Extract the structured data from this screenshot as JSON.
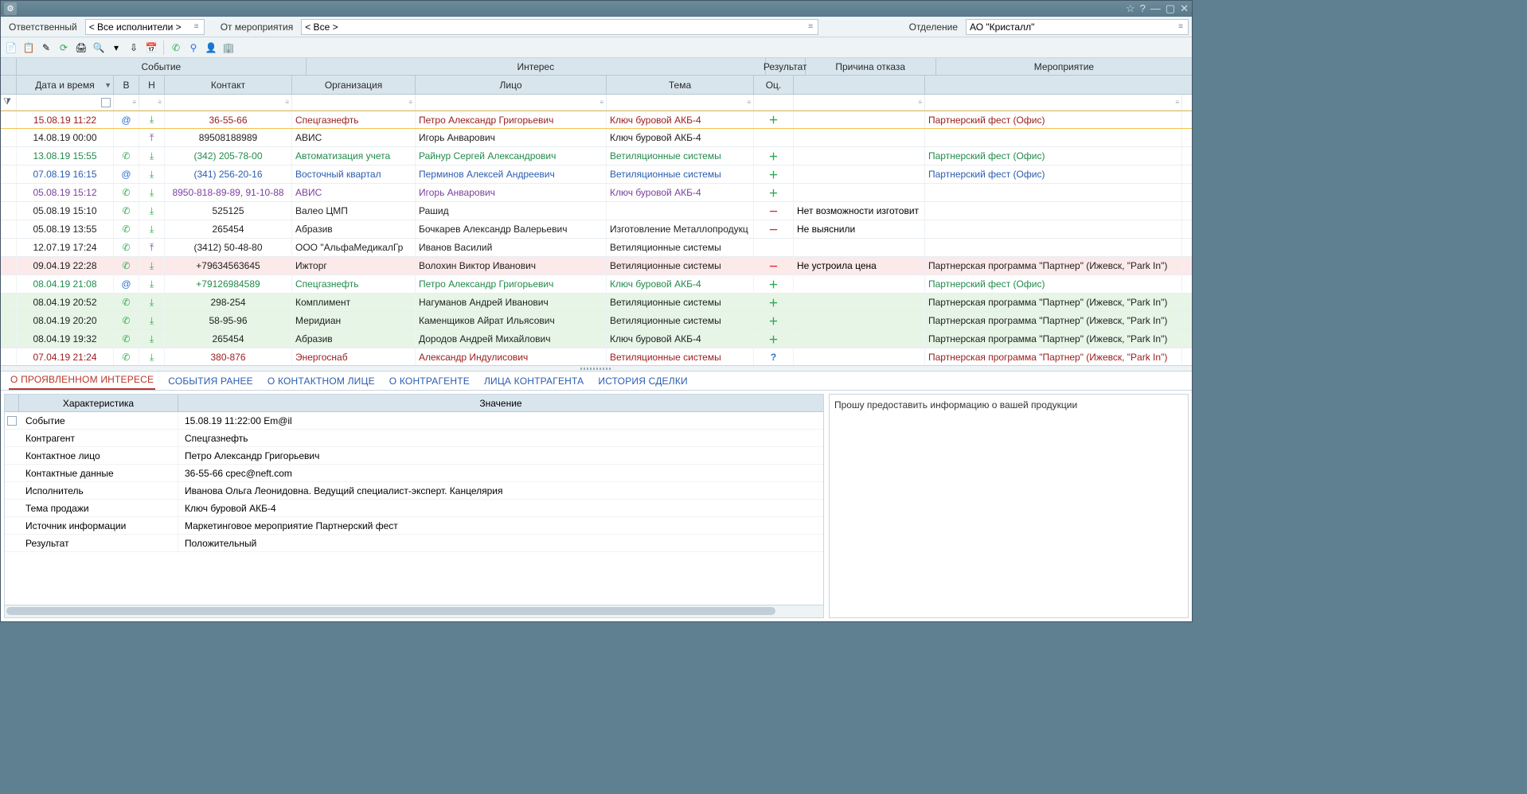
{
  "title": "",
  "filters": {
    "responsible_label": "Ответственный",
    "responsible_value": "< Все исполнители >",
    "from_event_label": "От мероприятия",
    "from_event_value": "< Все >",
    "department_label": "Отделение",
    "department_value": "АО \"Кристалл\""
  },
  "group_headers": {
    "event": "Событие",
    "interest": "Интерес",
    "result": "Результат",
    "reason": "Причина отказа",
    "meeting": "Мероприятие"
  },
  "columns": {
    "dt": "Дата и время",
    "v": "В",
    "h": "Н",
    "contact": "Контакт",
    "org": "Организация",
    "person": "Лицо",
    "theme": "Тема",
    "res": "Оц.",
    "reason": "",
    "meeting": ""
  },
  "rows": [
    {
      "dt": "15.08.19 11:22",
      "v": "at",
      "h": "in",
      "contact": "36-55-66",
      "org": "Спецгазнефть",
      "person": "Петро Александр Григорьевич",
      "theme": "Ключ буровой АКБ-4",
      "res": "plus",
      "reason": "",
      "meeting": "Партнерский фест (Офис)",
      "style": "darkred",
      "sel": true
    },
    {
      "dt": "14.08.19 00:00",
      "v": "",
      "h": "out",
      "contact": "89508188989",
      "org": "АВИС",
      "person": "Игорь Анварович",
      "theme": "Ключ буровой АКБ-4",
      "res": "",
      "reason": "",
      "meeting": "",
      "style": "black"
    },
    {
      "dt": "13.08.19 15:55",
      "v": "phone",
      "h": "in",
      "contact": "(342) 205-78-00",
      "org": "Автоматизация учета",
      "person": "Райнур Сергей Александрович",
      "theme": "Ветиляционные системы",
      "res": "plus",
      "reason": "",
      "meeting": "Партнерский фест (Офис)",
      "style": "green"
    },
    {
      "dt": "07.08.19 16:15",
      "v": "at",
      "h": "in",
      "contact": "(341) 256-20-16",
      "org": "Восточный квартал",
      "person": "Перминов Алексей Андреевич",
      "theme": "Ветиляционные системы",
      "res": "plus",
      "reason": "",
      "meeting": "Партнерский фест (Офис)",
      "style": "blue"
    },
    {
      "dt": "05.08.19 15:12",
      "v": "phone",
      "h": "in",
      "contact": "8950-818-89-89, 91-10-88",
      "org": "АВИС",
      "person": "Игорь Анварович",
      "theme": "Ключ буровой АКБ-4",
      "res": "plus",
      "reason": "",
      "meeting": "",
      "style": "purple"
    },
    {
      "dt": "05.08.19 15:10",
      "v": "phone",
      "h": "in",
      "contact": "525125",
      "org": "Валео ЦМП",
      "person": "Рашид",
      "theme": "",
      "res": "minus",
      "reason": "Нет возможности изготовит",
      "meeting": "",
      "style": "black"
    },
    {
      "dt": "05.08.19 13:55",
      "v": "phone",
      "h": "in",
      "contact": "265454",
      "org": "Абразив",
      "person": "Бочкарев Александр Валерьевич",
      "theme": "Изготовление Металлопродукц",
      "res": "minus",
      "reason": "Не выяснили",
      "meeting": "",
      "style": "black"
    },
    {
      "dt": "12.07.19 17:24",
      "v": "phone",
      "h": "out",
      "contact": "(3412) 50-48-80",
      "org": "ООО \"АльфаМедикалГр",
      "person": "Иванов Василий",
      "theme": "Ветиляционные системы",
      "res": "",
      "reason": "",
      "meeting": "",
      "style": "black"
    },
    {
      "dt": "09.04.19 22:28",
      "v": "phone",
      "h": "in",
      "contact": "+79634563645",
      "org": "Ижторг",
      "person": "Волохин Виктор Иванович",
      "theme": "Ветиляционные системы",
      "res": "minus",
      "reason": "Не устроила цена",
      "meeting": "Партнерская программа \"Партнер\" (Ижевск, \"Park In\")",
      "style": "black",
      "row": "pink"
    },
    {
      "dt": "08.04.19 21:08",
      "v": "at",
      "h": "in",
      "contact": "+79126984589",
      "org": "Спецгазнефть",
      "person": "Петро Александр Григорьевич",
      "theme": "Ключ буровой АКБ-4",
      "res": "plus",
      "reason": "",
      "meeting": "Партнерский фест (Офис)",
      "style": "green"
    },
    {
      "dt": "08.04.19 20:52",
      "v": "phone",
      "h": "in",
      "contact": "298-254",
      "org": "Комплимент",
      "person": "Нагуманов Андрей Иванович",
      "theme": "Ветиляционные системы",
      "res": "plus",
      "reason": "",
      "meeting": "Партнерская программа \"Партнер\" (Ижевск, \"Park In\")",
      "style": "black",
      "row": "green"
    },
    {
      "dt": "08.04.19 20:20",
      "v": "phone",
      "h": "in",
      "contact": "58-95-96",
      "org": "Меридиан",
      "person": "Каменщиков Айрат Ильясович",
      "theme": "Ветиляционные системы",
      "res": "plus",
      "reason": "",
      "meeting": "Партнерская программа \"Партнер\" (Ижевск, \"Park In\")",
      "style": "black",
      "row": "green"
    },
    {
      "dt": "08.04.19 19:32",
      "v": "phone",
      "h": "in",
      "contact": "265454",
      "org": "Абразив",
      "person": "Дородов Андрей Михайлович",
      "theme": "Ключ буровой АКБ-4",
      "res": "plus",
      "reason": "",
      "meeting": "Партнерская программа \"Партнер\" (Ижевск, \"Park In\")",
      "style": "black",
      "row": "green"
    },
    {
      "dt": "07.04.19 21:24",
      "v": "phone",
      "h": "in",
      "contact": "380-876",
      "org": "Энергоснаб",
      "person": "Александр Индулисович",
      "theme": "Ветиляционные системы",
      "res": "q",
      "reason": "",
      "meeting": "Партнерская программа \"Партнер\" (Ижевск, \"Park In\")",
      "style": "darkred"
    }
  ],
  "tabs": [
    "О ПРОЯВЛЕННОМ ИНТЕРЕСЕ",
    "СОБЫТИЯ РАНЕЕ",
    "О КОНТАКТНОМ ЛИЦЕ",
    "О КОНТРАГЕНТЕ",
    "ЛИЦА КОНТРАГЕНТА",
    "ИСТОРИЯ СДЕЛКИ"
  ],
  "detail": {
    "col_char": "Характеристика",
    "col_val": "Значение",
    "props": [
      {
        "k": "Событие",
        "v": "15.08.19 11:22:00 Em@il",
        "lead": "box"
      },
      {
        "k": "Контрагент",
        "v": "Спецгазнефть"
      },
      {
        "k": "Контактное лицо",
        "v": "Петро Александр Григорьевич"
      },
      {
        "k": "Контактные данные",
        "v": "36-55-66 cpec@neft.com"
      },
      {
        "k": "Исполнитель",
        "v": "Иванова Ольга Леонидовна. Ведущий  специалист-эксперт. Канцелярия"
      },
      {
        "k": "Тема продажи",
        "v": "Ключ буровой АКБ-4"
      },
      {
        "k": "Источник информации",
        "v": "Маркетинговое мероприятие Партнерский фест"
      },
      {
        "k": "Результат",
        "v": "Положительный"
      }
    ],
    "note": "Прошу предоставить информацию о вашей продукции"
  },
  "icons": {
    "phone": "✆",
    "at": "@",
    "in": "⤓",
    "out": "⤒",
    "plus": "＋",
    "minus": "－",
    "q": "?"
  }
}
